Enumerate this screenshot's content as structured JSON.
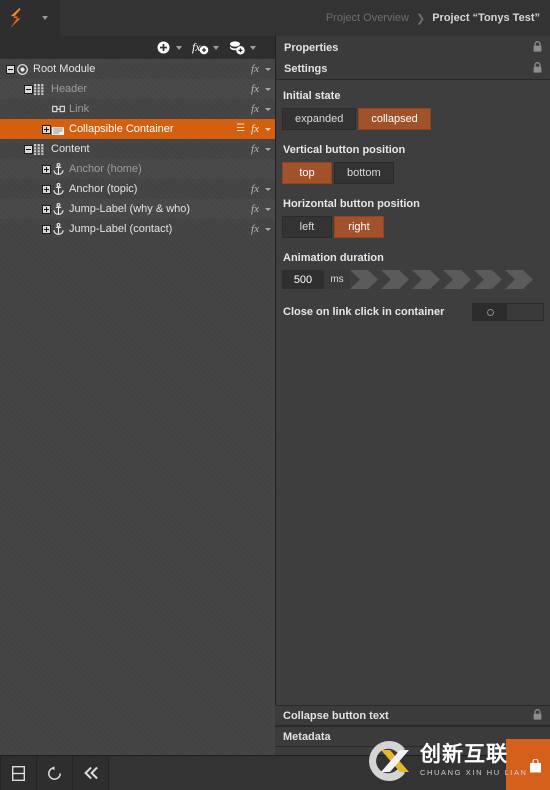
{
  "app": {
    "logo_icon": "zigzag-logo-icon",
    "logo_menu_icon": "caret-down-icon"
  },
  "breadcrumb": {
    "previous": "Project Overview",
    "separator": "❯",
    "current": "Project “Tonys Test”"
  },
  "toolbar": {
    "buttons": [
      {
        "name": "add-element-button",
        "icon": "plus-circle-icon",
        "caret": "caret-down-icon"
      },
      {
        "name": "add-function-button",
        "icon": "fx-plus-icon",
        "caret": "caret-down-icon"
      },
      {
        "name": "add-asset-button",
        "icon": "stack-plus-icon",
        "caret": "caret-down-icon"
      }
    ]
  },
  "properties_panel": {
    "title": "Properties",
    "lock_icon": "lock-icon",
    "sections": {
      "settings": {
        "title": "Settings",
        "lock_icon": "lock-icon"
      },
      "collapse_button_text": {
        "title": "Collapse button text",
        "lock_icon": "lock-icon"
      },
      "metadata": {
        "title": "Metadata"
      }
    },
    "fields": {
      "initial_state": {
        "label": "Initial state",
        "options": [
          "expanded",
          "collapsed"
        ],
        "selected": "collapsed"
      },
      "vertical_button_position": {
        "label": "Vertical button position",
        "options": [
          "top",
          "bottom"
        ],
        "selected": "top"
      },
      "horizontal_button_position": {
        "label": "Horizontal button position",
        "options": [
          "left",
          "right"
        ],
        "selected": "right"
      },
      "animation_duration": {
        "label": "Animation duration",
        "value": "500",
        "unit": "ms"
      },
      "close_on_link_click": {
        "label": "Close on link click in container",
        "state": "off",
        "knob_icon": "toggle-knob-icon"
      }
    }
  },
  "tree": {
    "rows": [
      {
        "label": "Root Module",
        "indent": 0,
        "expander": "minus",
        "icon": "target-module-icon",
        "fx": "fx",
        "fx_caret": true,
        "selected": false,
        "dim": false,
        "handle": false
      },
      {
        "label": "Header",
        "indent": 1,
        "expander": "minus",
        "icon": "container-grid-icon",
        "fx": "fx",
        "fx_caret": true,
        "selected": false,
        "dim": true,
        "handle": false
      },
      {
        "label": "Link",
        "indent": 2,
        "expander": "none",
        "icon": "link-icon",
        "fx": "fx",
        "fx_caret": true,
        "selected": false,
        "dim": true,
        "handle": false
      },
      {
        "label": "Collapsible Container",
        "indent": 2,
        "expander": "plus",
        "icon": "collapsible-box-icon",
        "fx": "fx",
        "fx_caret": true,
        "selected": true,
        "dim": false,
        "handle": true
      },
      {
        "label": "Content",
        "indent": 1,
        "expander": "minus",
        "icon": "container-grid-icon",
        "fx": "fx",
        "fx_caret": true,
        "selected": false,
        "dim": false,
        "handle": false
      },
      {
        "label": "Anchor (home)",
        "indent": 2,
        "expander": "plus",
        "icon": "anchor-icon",
        "fx": "",
        "fx_caret": false,
        "selected": false,
        "dim": true,
        "handle": false
      },
      {
        "label": "Anchor (topic)",
        "indent": 2,
        "expander": "plus",
        "icon": "anchor-icon",
        "fx": "fx",
        "fx_caret": true,
        "selected": false,
        "dim": false,
        "handle": false
      },
      {
        "label": "Jump-Label (why & who)",
        "indent": 2,
        "expander": "plus",
        "icon": "anchor-icon",
        "fx": "fx",
        "fx_caret": true,
        "selected": false,
        "dim": false,
        "handle": false
      },
      {
        "label": "Jump-Label (contact)",
        "indent": 2,
        "expander": "plus",
        "icon": "anchor-icon",
        "fx": "fx",
        "fx_caret": true,
        "selected": false,
        "dim": false,
        "handle": false
      }
    ]
  },
  "statusbar": {
    "buttons": [
      {
        "name": "toggle-panels-button",
        "icon": "split-panel-icon"
      },
      {
        "name": "reload-button",
        "icon": "refresh-icon"
      },
      {
        "name": "collapse-all-button",
        "icon": "double-chevron-left-icon"
      }
    ]
  },
  "watermark": {
    "chinese": "创新互联",
    "pinyin": "CHUANG XIN HU LIAN",
    "logo_icon": "cx-logo-icon",
    "accent_color": "#d4601c"
  },
  "colors": {
    "accent": "#d4600f",
    "muted_accent": "#a2522b",
    "panel_bg": "#3e3e3e",
    "tree_bg": "#444444",
    "chrome_bg": "#2e2e2e"
  }
}
